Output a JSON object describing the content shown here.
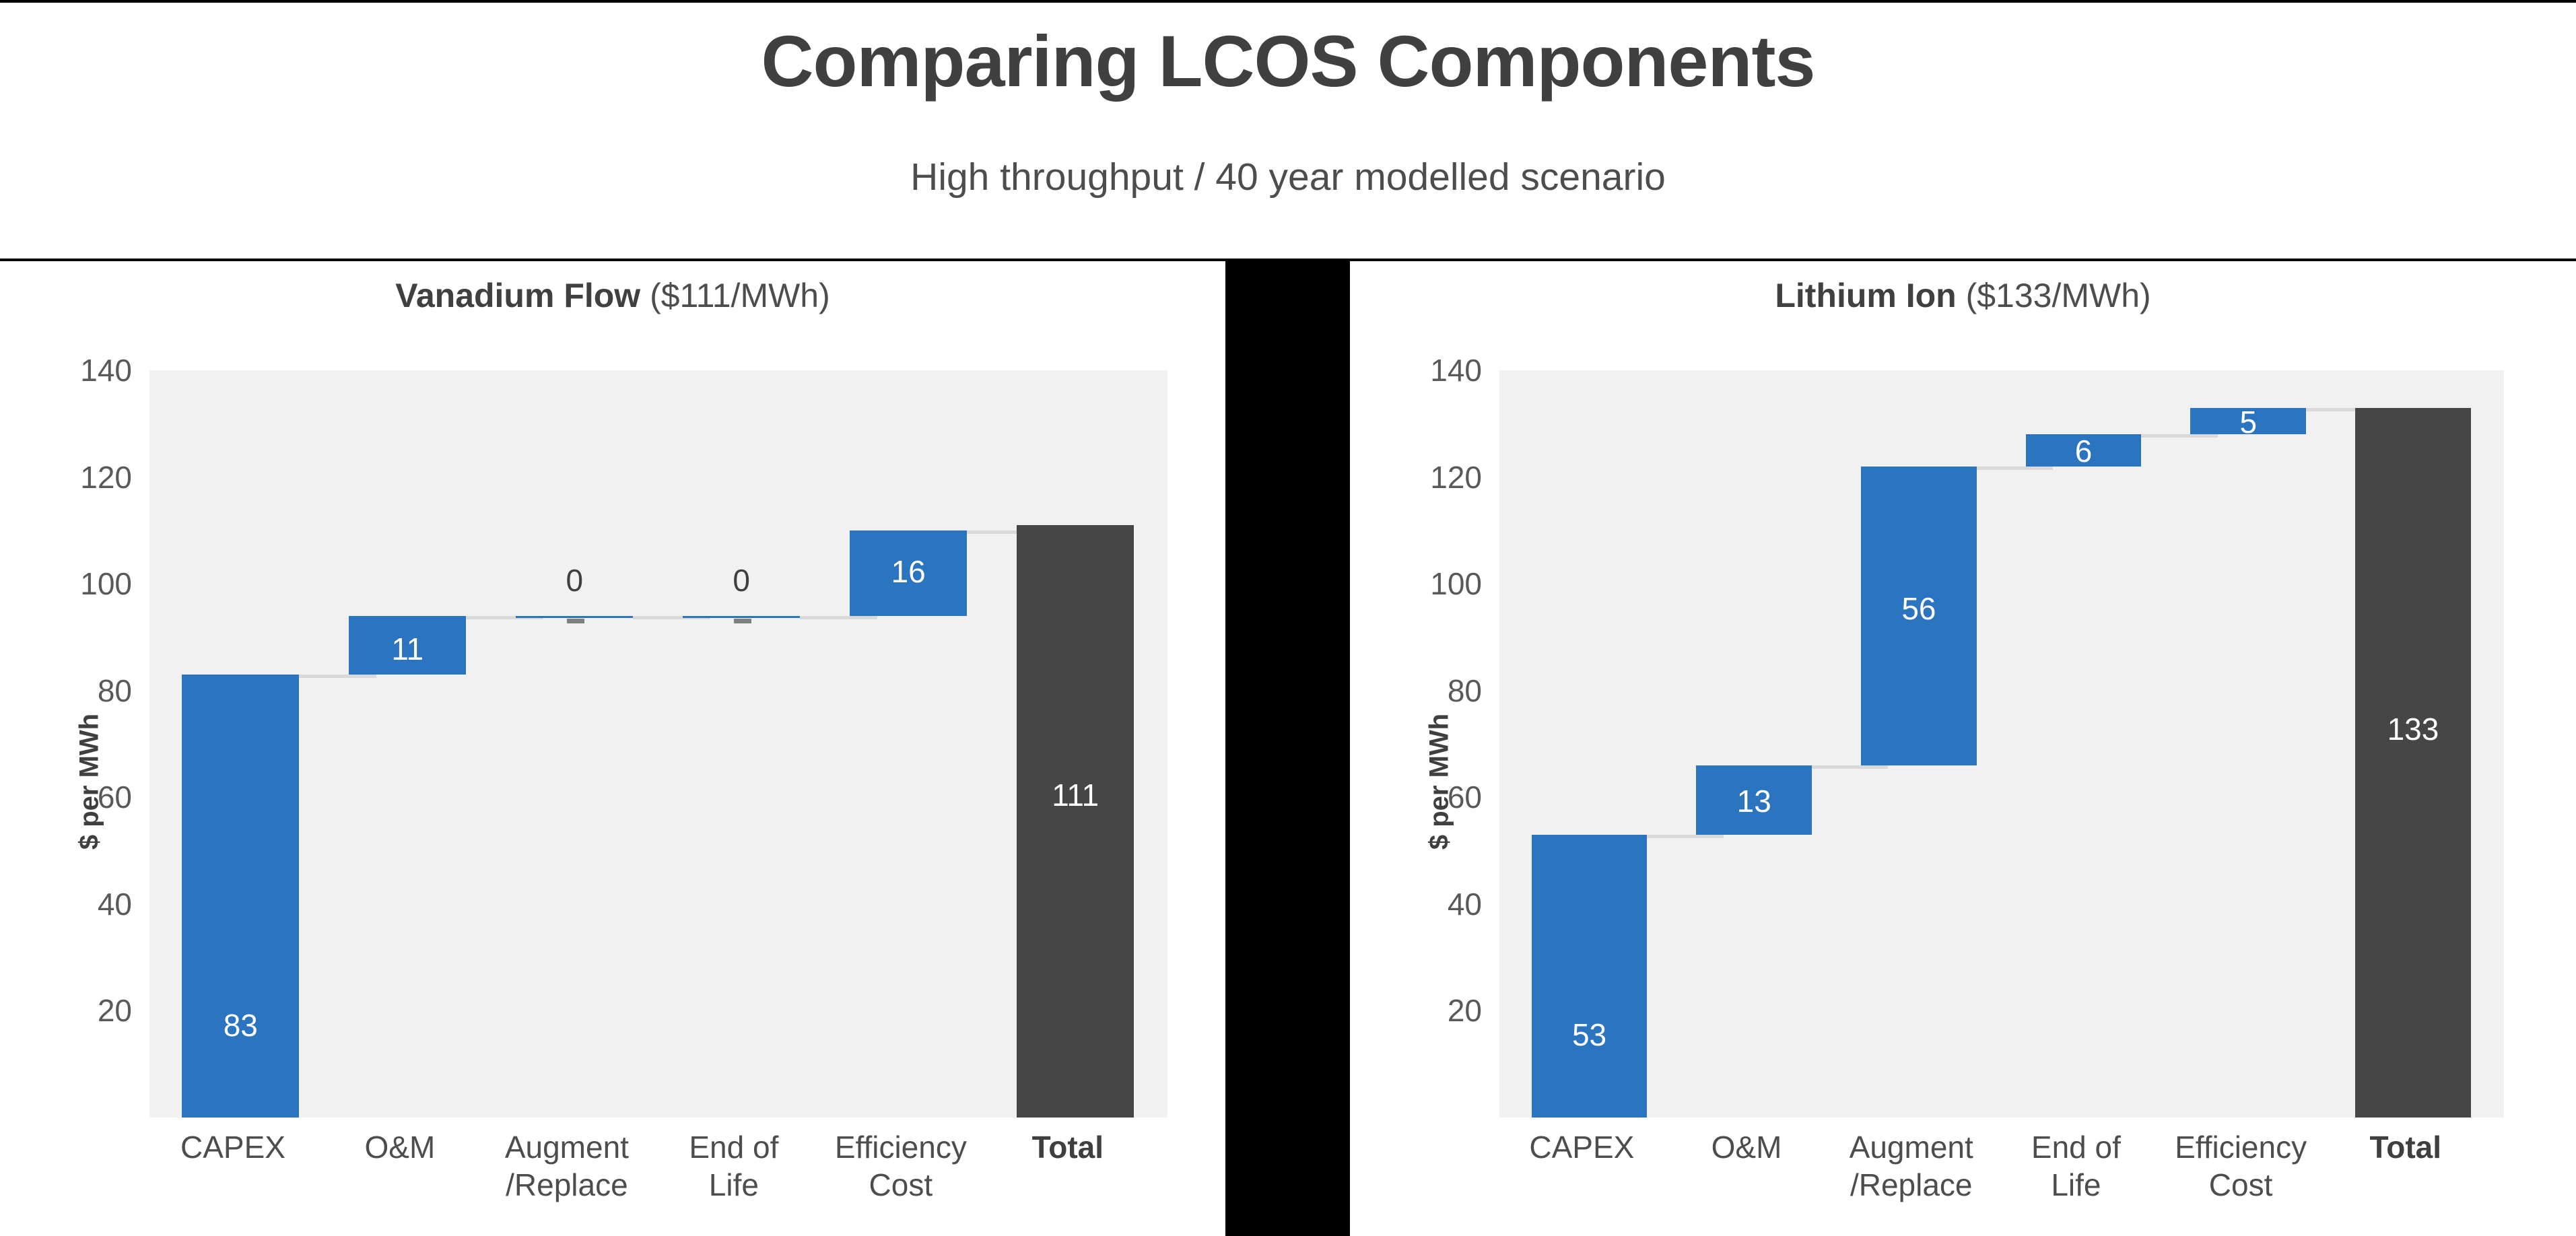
{
  "header": {
    "title": "Comparing LCOS Components",
    "subtitle": "High throughput / 40 year modelled scenario"
  },
  "charts": [
    {
      "title_bold": "Vanadium Flow",
      "title_rest": " ($111/MWh)"
    },
    {
      "title_bold": "Lithium Ion",
      "title_rest": " ($133/MWh)"
    }
  ],
  "axis": {
    "ylabel": "$ per MWh",
    "ticks": [
      "140",
      "120",
      "100",
      "80",
      "60",
      "40",
      "20",
      "-"
    ]
  },
  "colors": {
    "bar_blue": "#2b74c0",
    "bar_total": "#464646",
    "plot_background": "#f1f1f1",
    "connector": "#d9d9d9",
    "title_text": "#404040",
    "page_background": "#000000"
  },
  "chart_data": [
    {
      "type": "bar",
      "subtype": "waterfall",
      "title": "Vanadium Flow ($111/MWh)",
      "xlabel": "",
      "ylabel": "$ per MWh",
      "ylim": [
        0,
        140
      ],
      "yticks": [
        0,
        20,
        40,
        60,
        80,
        100,
        120,
        140
      ],
      "grid": false,
      "legend": "none",
      "categories": [
        "CAPEX",
        "O&M",
        "Augment\n/Replace",
        "End of\nLife",
        "Efficiency\nCost",
        "Total"
      ],
      "values": [
        83,
        11,
        0,
        0,
        16,
        111
      ],
      "labels": [
        "83",
        "11",
        "0",
        "0",
        "16",
        "111"
      ],
      "cumulative_start": [
        0,
        83,
        94,
        94,
        94,
        0
      ],
      "cumulative_end": [
        83,
        94,
        94,
        94,
        110,
        111
      ],
      "bar_kinds": [
        "delta",
        "delta",
        "delta",
        "delta",
        "delta",
        "total"
      ]
    },
    {
      "type": "bar",
      "subtype": "waterfall",
      "title": "Lithium Ion ($133/MWh)",
      "xlabel": "",
      "ylabel": "$ per MWh",
      "ylim": [
        0,
        140
      ],
      "yticks": [
        0,
        20,
        40,
        60,
        80,
        100,
        120,
        140
      ],
      "grid": false,
      "legend": "none",
      "categories": [
        "CAPEX",
        "O&M",
        "Augment\n/Replace",
        "End of\nLife",
        "Efficiency\nCost",
        "Total"
      ],
      "values": [
        53,
        13,
        56,
        6,
        5,
        133
      ],
      "labels": [
        "53",
        "13",
        "56",
        "6",
        "5",
        "133"
      ],
      "cumulative_start": [
        0,
        53,
        66,
        122,
        128,
        0
      ],
      "cumulative_end": [
        53,
        66,
        122,
        128,
        133,
        133
      ],
      "bar_kinds": [
        "delta",
        "delta",
        "delta",
        "delta",
        "delta",
        "total"
      ]
    }
  ],
  "categories": [
    {
      "lines": [
        "CAPEX"
      ],
      "bold": false
    },
    {
      "lines": [
        "O&M"
      ],
      "bold": false
    },
    {
      "lines": [
        "Augment",
        "/Replace"
      ],
      "bold": false
    },
    {
      "lines": [
        "End of",
        "Life"
      ],
      "bold": false
    },
    {
      "lines": [
        "Efficiency",
        "Cost"
      ],
      "bold": false
    },
    {
      "lines": [
        "Total"
      ],
      "bold": true
    }
  ],
  "bar_labels": {
    "left": [
      "83",
      "11",
      "0",
      "0",
      "16",
      "111"
    ],
    "right": [
      "53",
      "13",
      "56",
      "6",
      "5",
      "133"
    ]
  }
}
